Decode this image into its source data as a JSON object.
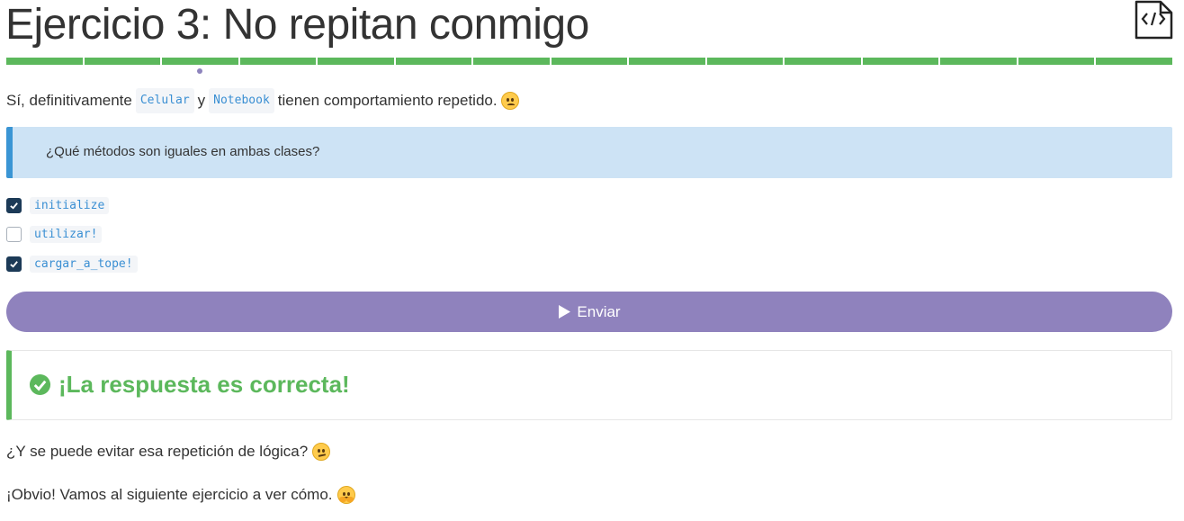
{
  "header": {
    "title": "Ejercicio 3: No repitan conmigo",
    "file_icon": "code-file-icon"
  },
  "progress": {
    "segments": 15,
    "completed": 15,
    "current_index": 2,
    "color": "#5cb85c"
  },
  "intro": {
    "prefix": "Sí, definitivamente",
    "code1": "Celular",
    "joiner": "y",
    "code2": "Notebook",
    "suffix": "tienen comportamiento repetido.",
    "emoji": "worried-face-emoji"
  },
  "question": {
    "text": "¿Qué métodos son iguales en ambas clases?"
  },
  "options": [
    {
      "label": "initialize",
      "checked": true
    },
    {
      "label": "utilizar!",
      "checked": false
    },
    {
      "label": "cargar_a_tope!",
      "checked": true
    }
  ],
  "submit": {
    "label": "Enviar",
    "icon": "play-icon",
    "color": "#8f82bd"
  },
  "result": {
    "text": "¡La respuesta es correcta!",
    "icon": "check-circle-icon",
    "color": "#5cb85c"
  },
  "followup": {
    "line1": "¿Y se puede evitar esa repetición de lógica?",
    "line1_emoji": "confused-face-emoji",
    "line2": "¡Obvio! Vamos al siguiente ejercicio a ver cómo.",
    "line2_emoji": "hugging-face-emoji"
  }
}
